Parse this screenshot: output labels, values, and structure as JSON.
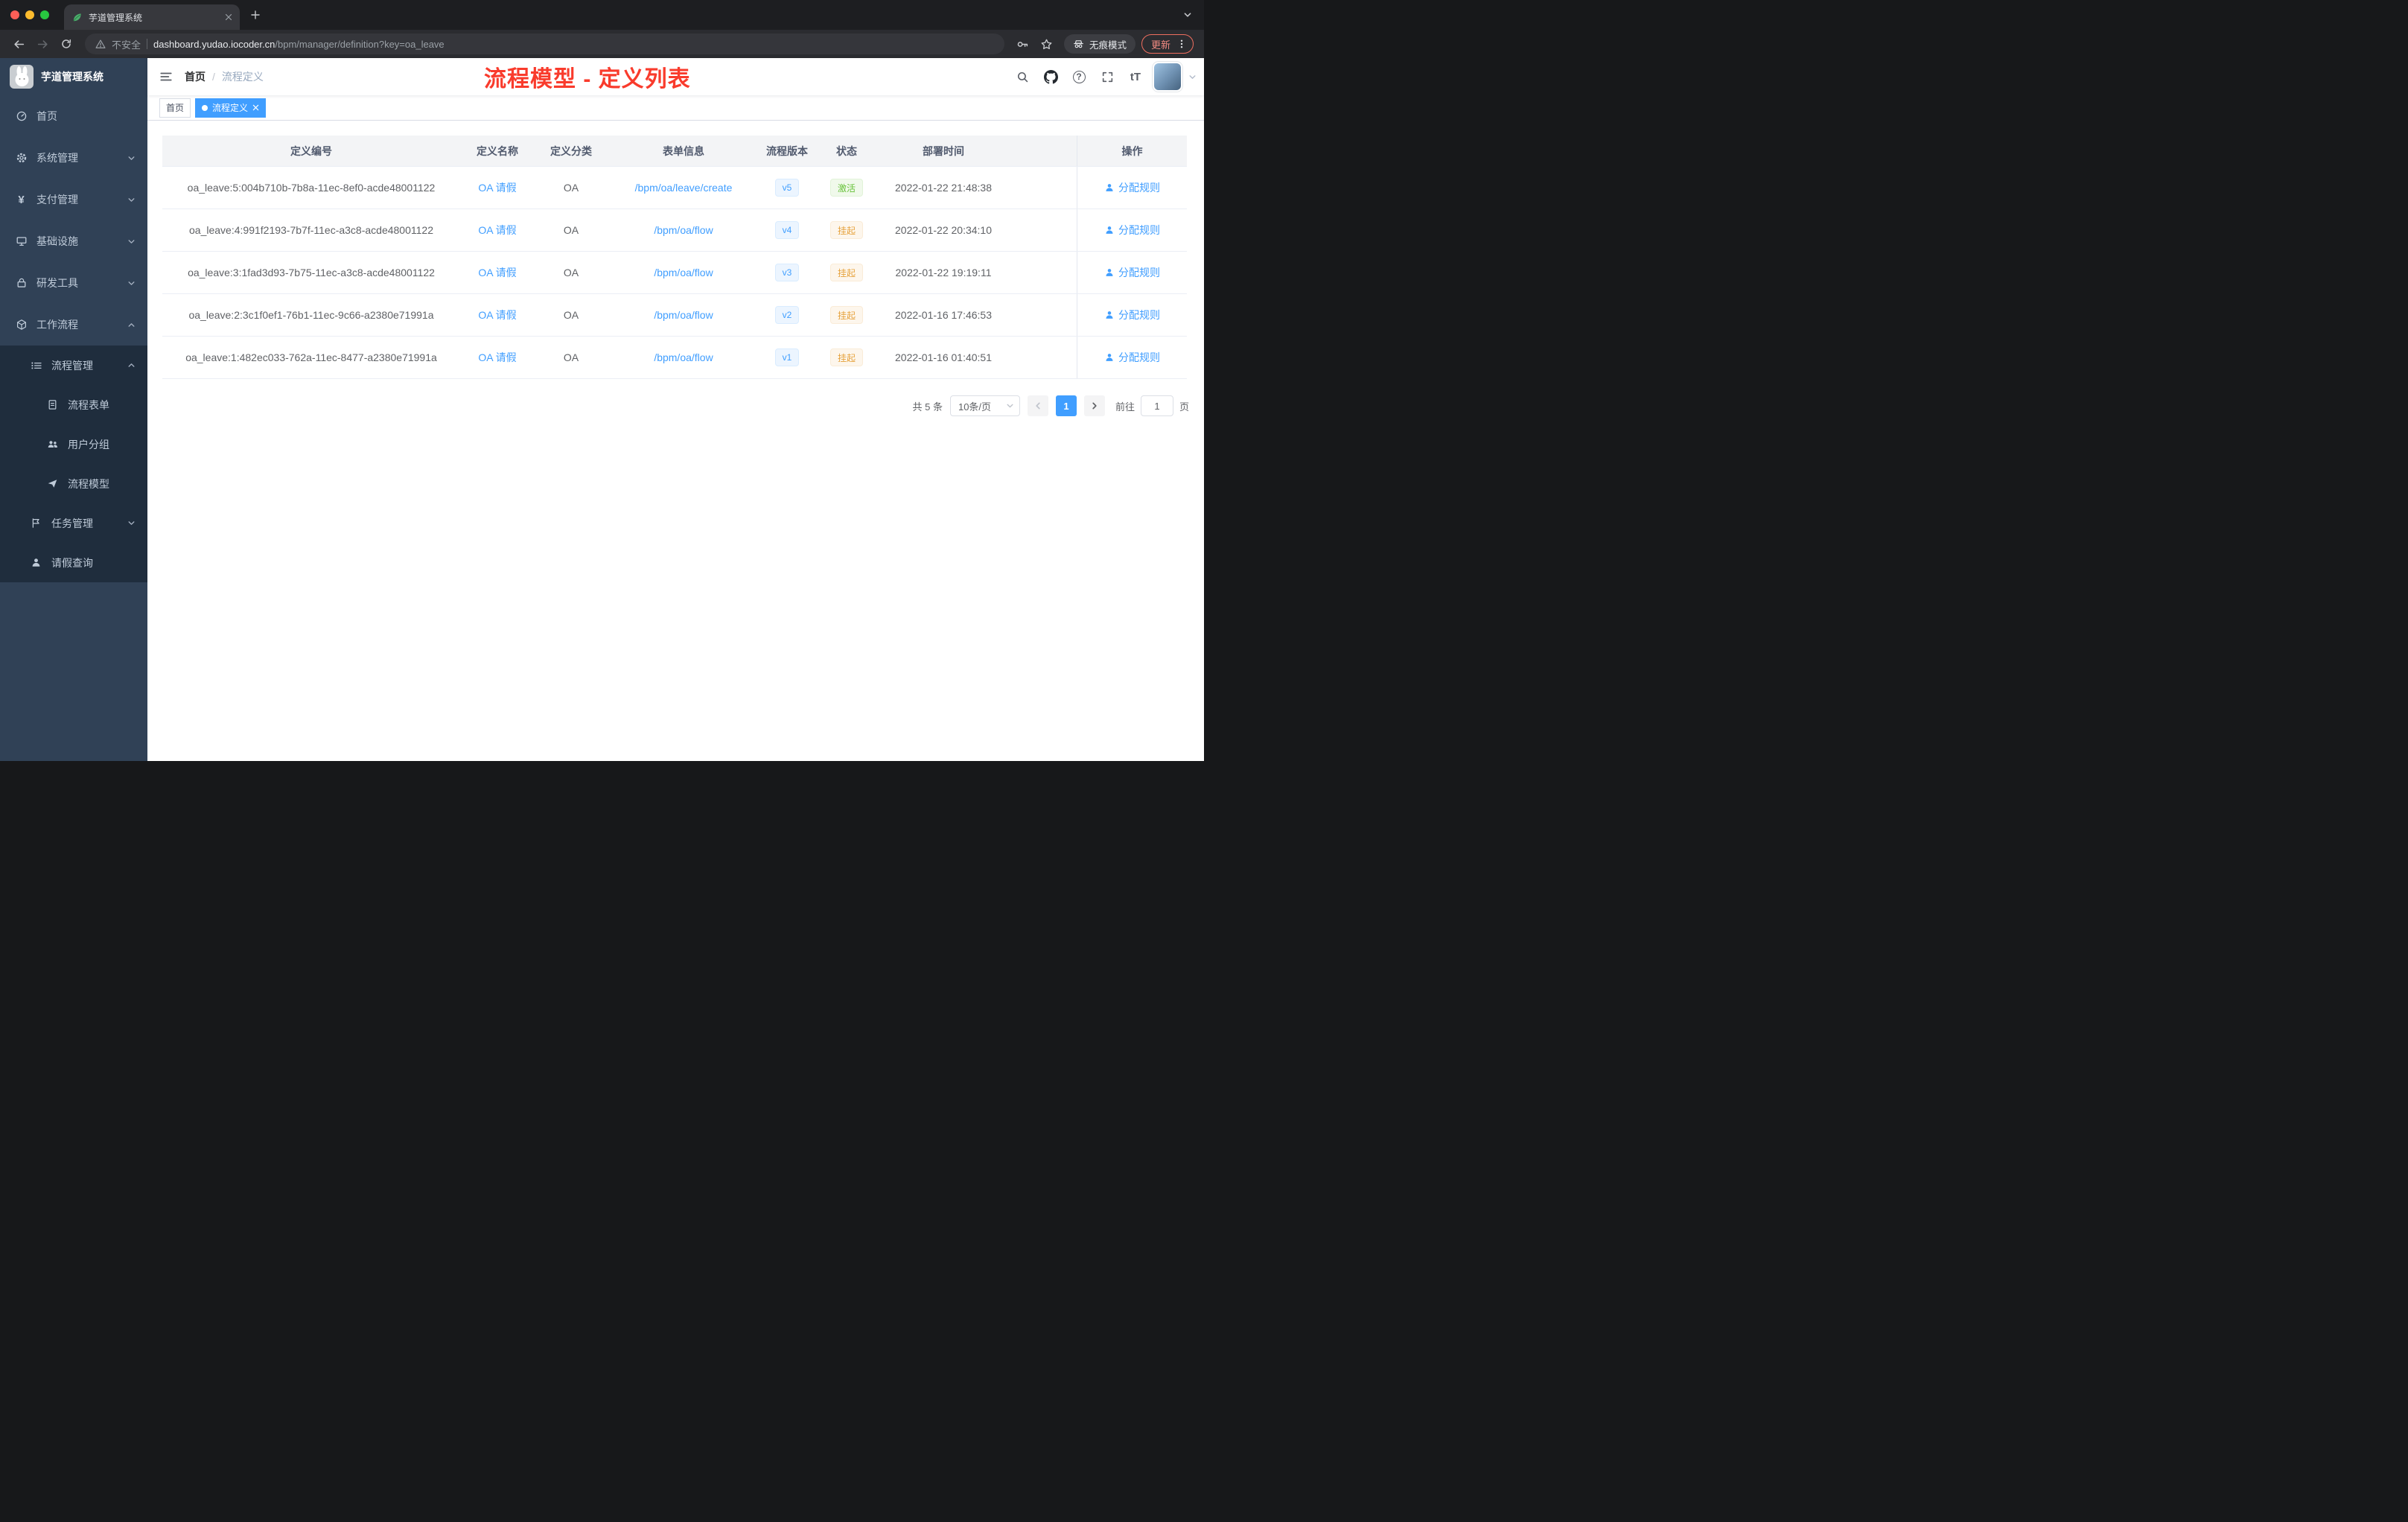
{
  "browser": {
    "tab_title": "芋道管理系统",
    "security_label": "不安全",
    "url_domain": "dashboard.yudao.iocoder.cn",
    "url_path": "/bpm/manager/definition?key=oa_leave",
    "incognito_label": "无痕模式",
    "update_label": "更新"
  },
  "sidebar": {
    "logo_title": "芋道管理系统",
    "yen_glyph": "¥",
    "items": [
      {
        "label": "首页"
      },
      {
        "label": "系统管理"
      },
      {
        "label": "支付管理"
      },
      {
        "label": "基础设施"
      },
      {
        "label": "研发工具"
      },
      {
        "label": "工作流程"
      },
      {
        "label": "流程管理"
      },
      {
        "label": "流程表单"
      },
      {
        "label": "用户分组"
      },
      {
        "label": "流程模型"
      },
      {
        "label": "任务管理"
      },
      {
        "label": "请假查询"
      }
    ]
  },
  "header": {
    "breadcrumb_home": "首页",
    "breadcrumb_separator": "/",
    "breadcrumb_current": "流程定义",
    "annotation": "流程模型 - 定义列表",
    "help_icon_glyph": "?",
    "fontsize_icon_label": "tT"
  },
  "tags": {
    "home": "首页",
    "current": "流程定义"
  },
  "table": {
    "columns": [
      "定义编号",
      "定义名称",
      "定义分类",
      "表单信息",
      "流程版本",
      "状态",
      "部署时间",
      "操作"
    ],
    "action_label": "分配规则",
    "rows": [
      {
        "id": "oa_leave:5:004b710b-7b8a-11ec-8ef0-acde48001122",
        "name": "OA 请假",
        "category": "OA",
        "form": "/bpm/oa/leave/create",
        "version": "v5",
        "status": "激活",
        "status_type": "success",
        "time": "2022-01-22 21:48:38"
      },
      {
        "id": "oa_leave:4:991f2193-7b7f-11ec-a3c8-acde48001122",
        "name": "OA 请假",
        "category": "OA",
        "form": "/bpm/oa/flow",
        "version": "v4",
        "status": "挂起",
        "status_type": "warning",
        "time": "2022-01-22 20:34:10"
      },
      {
        "id": "oa_leave:3:1fad3d93-7b75-11ec-a3c8-acde48001122",
        "name": "OA 请假",
        "category": "OA",
        "form": "/bpm/oa/flow",
        "version": "v3",
        "status": "挂起",
        "status_type": "warning",
        "time": "2022-01-22 19:19:11"
      },
      {
        "id": "oa_leave:2:3c1f0ef1-76b1-11ec-9c66-a2380e71991a",
        "name": "OA 请假",
        "category": "OA",
        "form": "/bpm/oa/flow",
        "version": "v2",
        "status": "挂起",
        "status_type": "warning",
        "time": "2022-01-16 17:46:53"
      },
      {
        "id": "oa_leave:1:482ec033-762a-11ec-8477-a2380e71991a",
        "name": "OA 请假",
        "category": "OA",
        "form": "/bpm/oa/flow",
        "version": "v1",
        "status": "挂起",
        "status_type": "warning",
        "time": "2022-01-16 01:40:51"
      }
    ]
  },
  "pagination": {
    "total": "共 5 条",
    "page_size": "10条/页",
    "current_page": "1",
    "goto_label": "前往",
    "goto_value": "1",
    "page_unit": "页"
  }
}
